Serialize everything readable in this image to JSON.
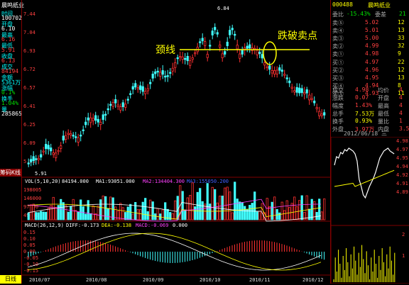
{
  "header": {
    "stock_name": "晨鸣纸业",
    "code": "000488",
    "title_right": "晨鸣纸业"
  },
  "left_panel": {
    "items": [
      {
        "label": "时间",
        "value": "100702"
      },
      {
        "label": "开盘",
        "value": "6.10"
      },
      {
        "label": "最高",
        "value": "6.16"
      },
      {
        "label": "最低",
        "value": "5.91"
      },
      {
        "label": "收盘",
        "value": "6.13"
      },
      {
        "label": "成交",
        "value": "84194"
      },
      {
        "label": "金额",
        "value": "5361万"
      },
      {
        "label": "涨幅",
        "value": "0.1%"
      },
      {
        "label": "换手",
        "value": "1.04%"
      },
      {
        "label": "量",
        "value": "285865"
      }
    ]
  },
  "chart_labels": {
    "high_price": "6.84",
    "low_price": "5.91",
    "neckline": "颈线",
    "break_sell": "跌破卖点",
    "indicator_tab": "筹码K线",
    "bottom_tab": "日线"
  },
  "y_axis_price": [
    "7.44",
    "7.04",
    "6.93",
    "6.72",
    "6.57",
    "6.41",
    "6.25",
    "6.09",
    "5.93"
  ],
  "vol_panel": {
    "title": "VOL(5,10,20)",
    "value": "84194.000",
    "ma1": "MA1:93051.000",
    "ma2": "MA2:134404.300",
    "ma3": "MA3:155050.200",
    "y_ticks": [
      "198005",
      "146000",
      "97000",
      "49400"
    ]
  },
  "macd_panel": {
    "title": "MACD(26,12,9)",
    "dif": "DIFF:-0.173",
    "dea": "DEA:-0.138",
    "macd": "MACD:-0.069",
    "extra": "0.000",
    "y_ticks": [
      "0.15",
      "0.10",
      "0.05",
      "0.00",
      "-0.05",
      "-0.10",
      "-0.15"
    ]
  },
  "x_axis": [
    "2010/07",
    "2010/08",
    "2010/09",
    "2010/10",
    "2010/11",
    "2010/12"
  ],
  "order_book": {
    "weibi_label": "委比",
    "weibi": "-15.43%",
    "weicha_label": "委差",
    "weicha": "21",
    "sell": [
      {
        "label": "卖⑤",
        "price": "5.02",
        "vol": "12"
      },
      {
        "label": "卖④",
        "price": "5.01",
        "vol": "13"
      },
      {
        "label": "卖③",
        "price": "5.00",
        "vol": "33"
      },
      {
        "label": "卖②",
        "price": "4.99",
        "vol": "32"
      },
      {
        "label": "卖①",
        "price": "4.98",
        "vol": "9"
      }
    ],
    "buy": [
      {
        "label": "买①",
        "price": "4.97",
        "vol": "22"
      },
      {
        "label": "买②",
        "price": "4.96",
        "vol": "12"
      },
      {
        "label": "买③",
        "price": "4.95",
        "vol": "13"
      },
      {
        "label": "买④",
        "price": "4.94",
        "vol": "8"
      },
      {
        "label": "买⑤",
        "price": "4.93",
        "vol": "11"
      }
    ]
  },
  "stats": [
    {
      "l1": "成交",
      "v1": "4.98",
      "l2": "均价",
      "v2": "4"
    },
    {
      "l1": "涨跌",
      "v1": "0.07",
      "l2": "开盘",
      "v2": "4"
    },
    {
      "l1": "幅度",
      "v1": "1.43%",
      "l2": "最高",
      "v2": "4"
    },
    {
      "l1": "总手",
      "v1": "7.53万",
      "l2": "最低",
      "v2": "4"
    },
    {
      "l1": "换手",
      "v1": "0.93%",
      "l2": "量比",
      "v2": "1"
    },
    {
      "l1": "外盘",
      "v1": "3.97万",
      "l2": "内盘",
      "v2": "3.56"
    }
  ],
  "intraday": {
    "date_label": "2012/06/18 三",
    "y_ticks": [
      "4.98",
      "4.97",
      "4.95",
      "4.94",
      "4.92",
      "4.91",
      "4.89"
    ],
    "vol_ticks": [
      "2",
      "1"
    ]
  }
}
